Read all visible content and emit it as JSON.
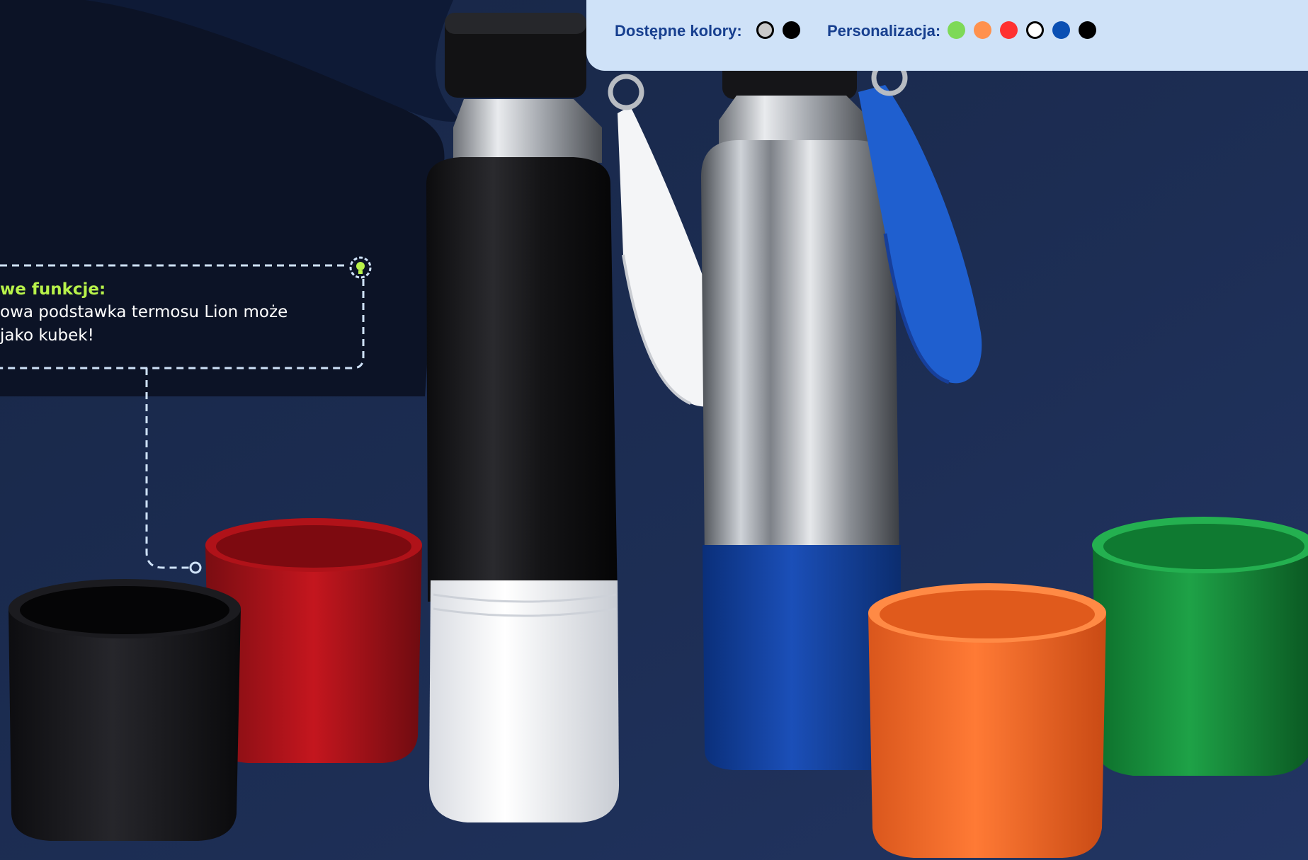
{
  "topbar": {
    "colors_label": "Dostępne kolory:",
    "personalization_label": "Personalizacja:",
    "available_colors": [
      "#c9c9c9",
      "#000000"
    ],
    "personalization_colors": [
      "#7ed957",
      "#ff914d",
      "#ff3131",
      "#ffffff",
      "#0a4fb3",
      "#000000"
    ]
  },
  "callout": {
    "title": "we funkcje:",
    "line1": "owa podstawka termosu Lion może",
    "line2": "jako kubek!",
    "icon": "lightbulb-icon"
  },
  "photo": {
    "subject": "thermos bottles and colored cup bases",
    "colors": {
      "background": "#1a2a4f",
      "callout_accent": "#b8f24a",
      "brand_blue": "#173f8f"
    }
  }
}
